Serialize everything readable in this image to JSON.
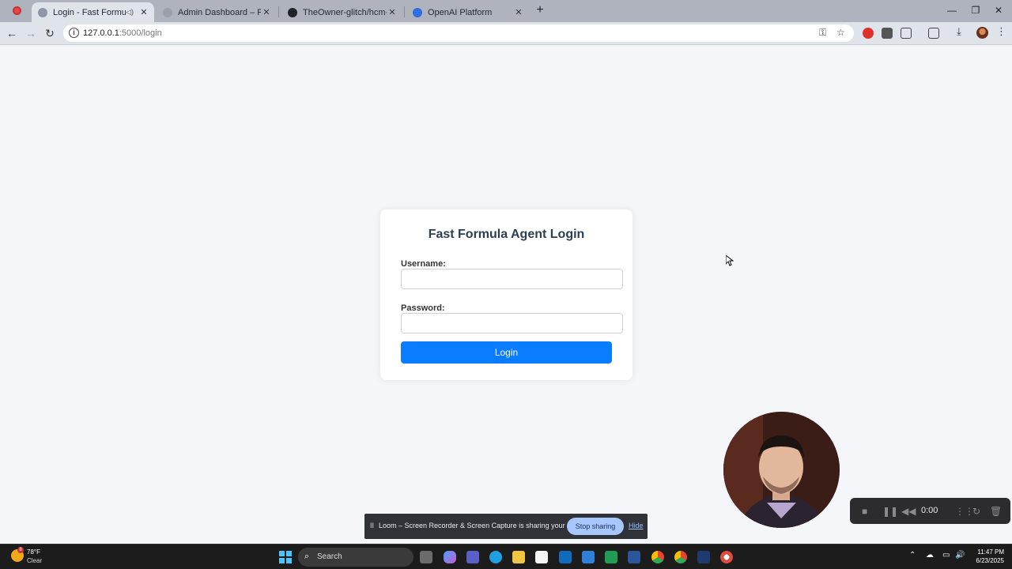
{
  "browser": {
    "tabs": [
      {
        "label": "Login - Fast Formula Agent",
        "active": true
      },
      {
        "label": "Admin Dashboard – Fast Formula Agent",
        "active": false
      },
      {
        "label": "TheOwner-glitch/hcm-fast-formula",
        "active": false
      },
      {
        "label": "OpenAI Platform",
        "active": false
      }
    ],
    "new_tab_icon": "plus-icon",
    "url_host": "127.0.0.1",
    "url_path": ":5000/login"
  },
  "login": {
    "title": "Fast Formula Agent Login",
    "username_label": "Username:",
    "username_value": "",
    "password_label": "Password:",
    "password_value": "",
    "button_label": "Login"
  },
  "loom": {
    "share_text": "Loom – Screen Recorder & Screen Capture is sharing your screen.",
    "stop_label": "Stop sharing",
    "hide_label": "Hide",
    "timer": "0:00"
  },
  "taskbar": {
    "weather_temp": "78°F",
    "weather_cond": "Clear",
    "weather_badge": "8",
    "search_label": "Search",
    "time": "11:47 PM",
    "date": "6/23/2025"
  },
  "colors": {
    "primary_button": "#0a7cff",
    "page_bg": "#f4f6f9",
    "title_text": "#2c3e50"
  }
}
